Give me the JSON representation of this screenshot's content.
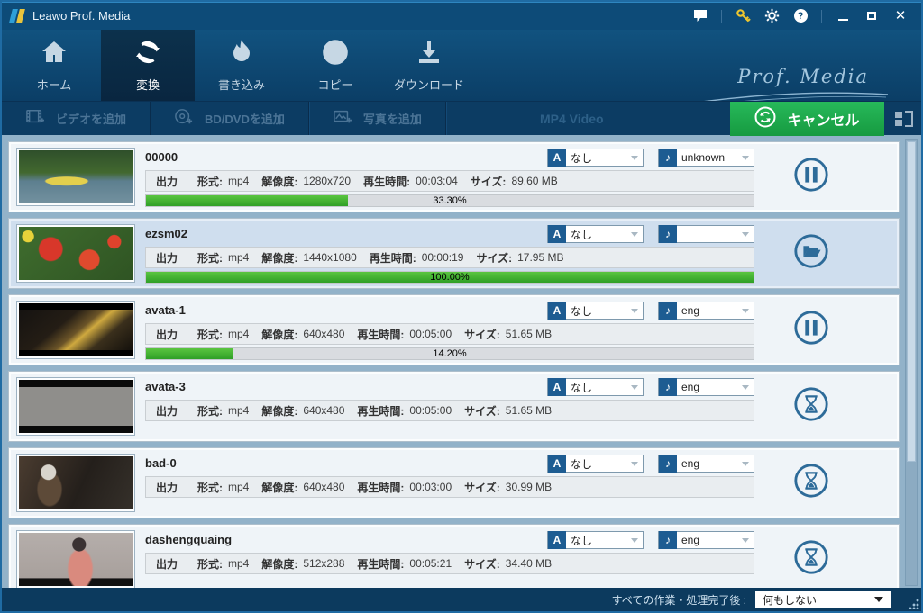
{
  "window": {
    "title": "Leawo Prof. Media"
  },
  "nav": {
    "tabs": [
      {
        "label": "ホーム"
      },
      {
        "label": "変換"
      },
      {
        "label": "書き込み"
      },
      {
        "label": "コピー"
      },
      {
        "label": "ダウンロード"
      }
    ],
    "brand": "Prof. Media"
  },
  "toolbar": {
    "add_video": "ビデオを追加",
    "add_bd_dvd": "BD/DVDを追加",
    "add_photo": "写真を追加",
    "profile": "MP4 Video",
    "cancel_label": "キャンセル"
  },
  "field_labels": {
    "output": "出力",
    "format": "形式:",
    "resolution": "解像度:",
    "duration": "再生時間:",
    "size": "サイズ:"
  },
  "rows": [
    {
      "name": "00000",
      "format": "mp4",
      "resolution": "1280x720",
      "duration": "00:03:04",
      "size": "89.60 MB",
      "subtitle": "なし",
      "audio": "unknown",
      "progress": 33.3,
      "progress_text": "33.30%",
      "action": "pause"
    },
    {
      "name": "ezsm02",
      "format": "mp4",
      "resolution": "1440x1080",
      "duration": "00:00:19",
      "size": "17.95 MB",
      "subtitle": "なし",
      "audio": "",
      "progress": 100,
      "progress_text": "100.00%",
      "action": "open-folder"
    },
    {
      "name": "avata-1",
      "format": "mp4",
      "resolution": "640x480",
      "duration": "00:05:00",
      "size": "51.65 MB",
      "subtitle": "なし",
      "audio": "eng",
      "progress": 14.2,
      "progress_text": "14.20%",
      "action": "pause"
    },
    {
      "name": "avata-3",
      "format": "mp4",
      "resolution": "640x480",
      "duration": "00:05:00",
      "size": "51.65 MB",
      "subtitle": "なし",
      "audio": "eng",
      "action": "waiting"
    },
    {
      "name": "bad-0",
      "format": "mp4",
      "resolution": "640x480",
      "duration": "00:03:00",
      "size": "30.99 MB",
      "subtitle": "なし",
      "audio": "eng",
      "action": "waiting"
    },
    {
      "name": "dashengquaing",
      "format": "mp4",
      "resolution": "512x288",
      "duration": "00:05:21",
      "size": "34.40 MB",
      "subtitle": "なし",
      "audio": "eng",
      "action": "waiting"
    }
  ],
  "statusbar": {
    "label": "すべての作業・処理完了後 :",
    "after_action": "何もしない"
  },
  "colors": {
    "titlebar": "#0d4b78",
    "selected_tab": "#0a2c46",
    "accent_green": "#1fae4b",
    "progress_green": "#3eb12c",
    "action_icon": "#2d6b99"
  }
}
